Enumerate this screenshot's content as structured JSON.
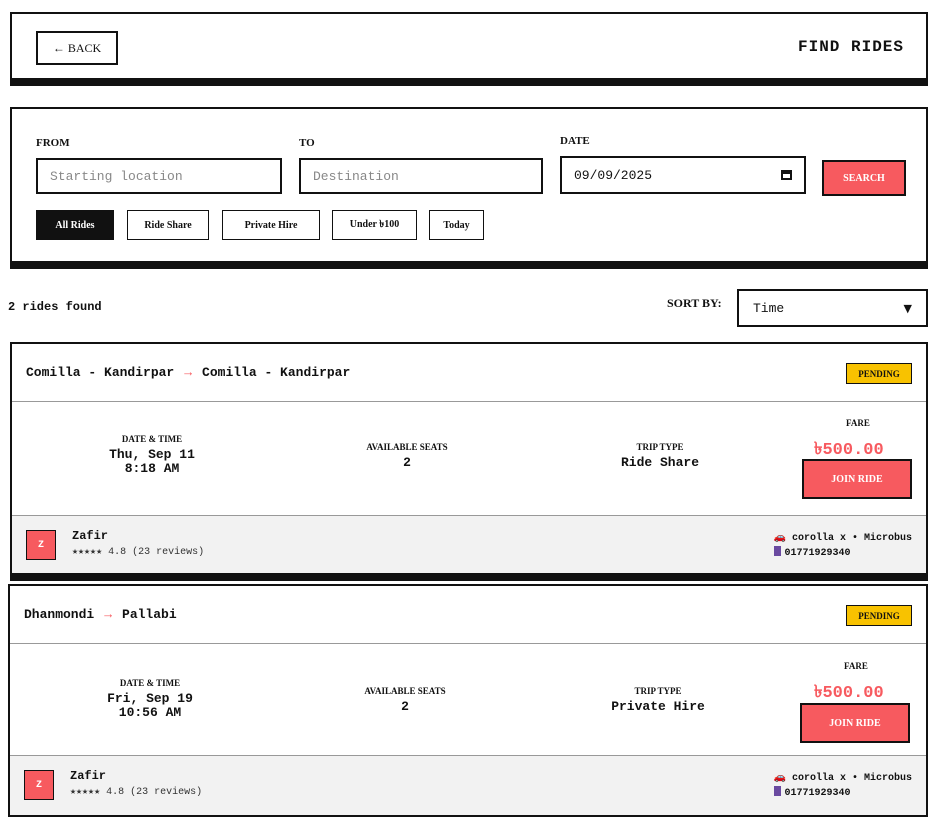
{
  "header": {
    "back_label": "← BACK",
    "title": "FIND RIDES"
  },
  "search": {
    "from_label": "FROM",
    "from_placeholder": "Starting location",
    "to_label": "TO",
    "to_placeholder": "Destination",
    "date_label": "DATE",
    "date_value": "09/09/2025",
    "search_label": "SEARCH",
    "filters": [
      {
        "label": "All Rides",
        "active": true
      },
      {
        "label": "Ride Share",
        "active": false
      },
      {
        "label": "Private Hire",
        "active": false
      },
      {
        "label": "Under ৳100",
        "active": false
      },
      {
        "label": "Today",
        "active": false
      }
    ]
  },
  "results": {
    "count_text": "2 rides found",
    "sort_label": "SORT BY:",
    "sort_value": "Time"
  },
  "labels": {
    "date_time": "DATE & TIME",
    "seats": "AVAILABLE SEATS",
    "trip_type": "TRIP TYPE",
    "fare": "FARE",
    "join": "JOIN RIDE"
  },
  "rides": [
    {
      "from": "Comilla - Kandirpar",
      "to": "Comilla - Kandirpar",
      "status": "PENDING",
      "day": "Thu, Sep 11",
      "time": "8:18 AM",
      "seats": "2",
      "trip_type": "Ride Share",
      "fare": "৳500.00",
      "driver_initial": "Z",
      "driver": "Zafir",
      "rating": "★★★★★ 4.8 (23 reviews)",
      "vehicle": "corolla x • Microbus",
      "phone": "01771929340"
    },
    {
      "from": "Dhanmondi",
      "to": "Pallabi",
      "status": "PENDING",
      "day": "Fri, Sep 19",
      "time": "10:56 AM",
      "seats": "2",
      "trip_type": "Private Hire",
      "fare": "৳500.00",
      "driver_initial": "Z",
      "driver": "Zafir",
      "rating": "★★★★★ 4.8 (23 reviews)",
      "vehicle": "corolla x • Microbus",
      "phone": "01771929340"
    }
  ],
  "colors": {
    "accent": "#f75a5f",
    "badge": "#f8c200",
    "border": "#111111"
  }
}
